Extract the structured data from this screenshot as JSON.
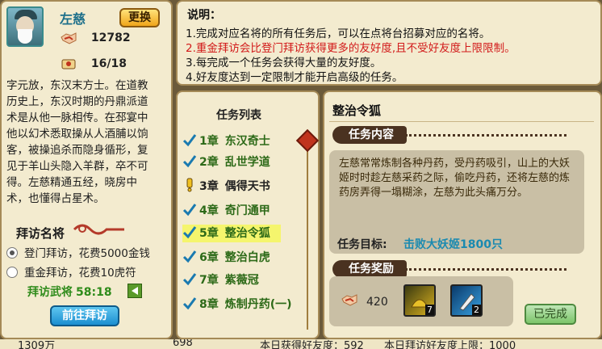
{
  "hero": {
    "name": "左慈",
    "swap_label": "更换",
    "stat1": "12782",
    "stat2": "16/18",
    "bio": "字元放，东汉末方士。在道教历史上，东汉时期的丹鼎派道术是从他一脉相传。在邳宴中他以幻术悉取操从人酒脯以饷客，被操追杀而隐身循形，复见于羊山头隐入羊群，卒不可得。左慈精通五经，晓房中术，也懂得占星术。"
  },
  "visit": {
    "title": "拜访名将",
    "option1": "登门拜访，花费5000金钱",
    "option2": "重金拜访，花费10虎符",
    "timer_label": "拜访武将",
    "timer_value": "58:18",
    "go_label": "前往拜访"
  },
  "notes": {
    "title": "说明：",
    "lines": [
      "1.完成对应名将的所有任务后，可以在点将台招募对应的名将。",
      "2.重金拜访会比登门拜访获得更多的友好度,且不受好友度上限限制。",
      "3.每完成一个任务会获得大量的友好度。",
      "4.好友度达到一定限制才能开启高级的任务。"
    ]
  },
  "tasks": {
    "title": "任务列表",
    "items": [
      {
        "chapter": "1章",
        "name": "东汉奇士",
        "status": "check"
      },
      {
        "chapter": "2章",
        "name": "乱世学道",
        "status": "check"
      },
      {
        "chapter": "3章",
        "name": "偶得天书",
        "status": "current"
      },
      {
        "chapter": "4章",
        "name": "奇门通甲",
        "status": "check"
      },
      {
        "chapter": "5章",
        "name": "整治令狐",
        "status": "check"
      },
      {
        "chapter": "6章",
        "name": "整治白虎",
        "status": "check"
      },
      {
        "chapter": "7章",
        "name": "紫薇冠",
        "status": "check"
      },
      {
        "chapter": "8章",
        "name": "炼制丹药(一)",
        "status": "check"
      }
    ],
    "selected_index": 4
  },
  "detail": {
    "title": "整治令狐",
    "content_banner": "任务内容",
    "description": "左慈常常炼制各种丹药，受丹药吸引，山上的大妖姬时时趁左慈采药之际，偷吃丹药，还将左慈的炼药房弄得一塌糊涂，左慈为此头痛万分。",
    "goal_label": "任务目标:",
    "goal_value": "击败大妖姬1800只",
    "reward_banner": "任务奖励",
    "reward_amount": "420",
    "item1_qty": "7",
    "item2_qty": "2",
    "done_label": "已完成"
  },
  "bottom": {
    "left_value": "1309万",
    "mid_value": "698",
    "today_gain": "本日获得好友度：592",
    "today_limit": "本日拜访好友度上限：1000"
  },
  "colors": {
    "accent_green": "#2e8b1a",
    "accent_blue": "#1a8ab0",
    "note_red": "#d21a1a",
    "selected_row": "#f5f56d"
  }
}
